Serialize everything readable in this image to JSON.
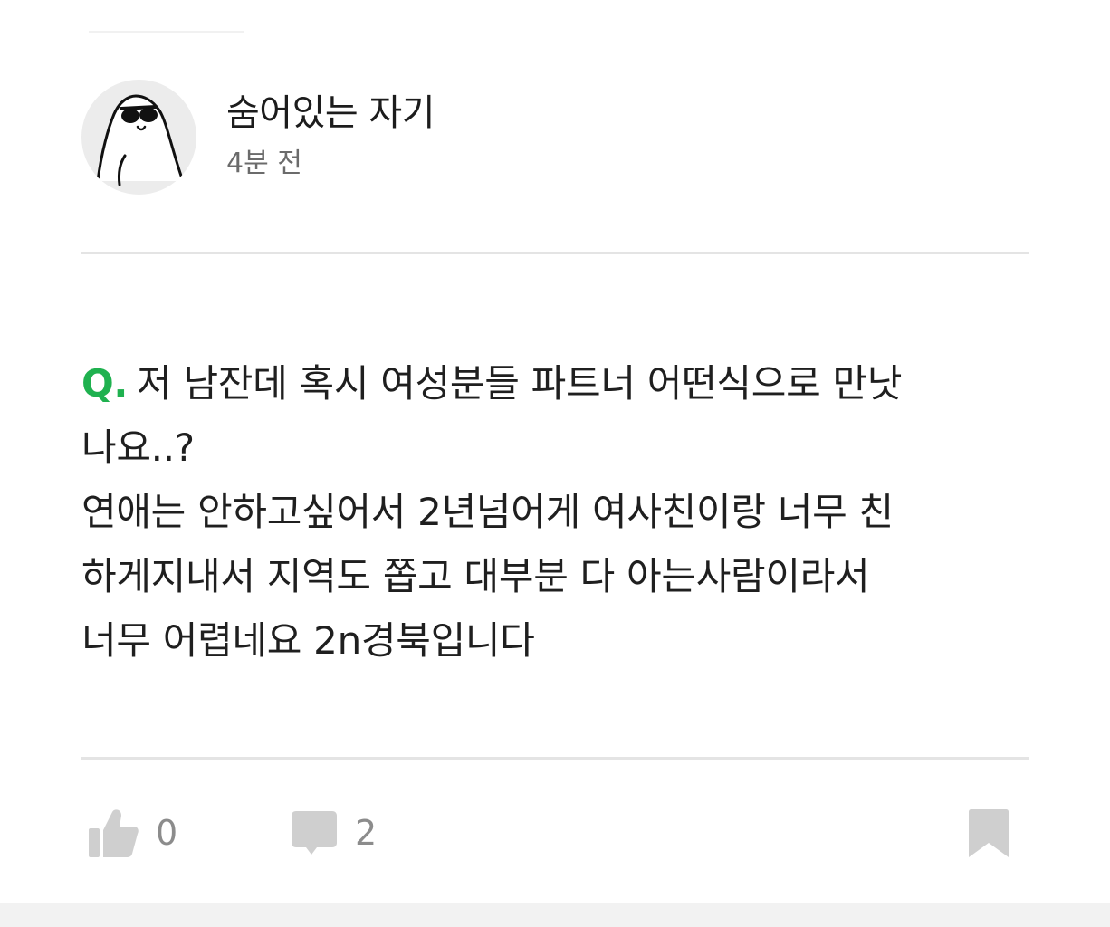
{
  "author": {
    "name": "숨어있는 자기",
    "time": "4분 전"
  },
  "question": {
    "marker": "Q.",
    "lines": [
      "저 남잔데 혹시 여성분들 파트너 어떤식으로 만낫",
      "나요..?",
      "연애는 안하고싶어서 2년넘어게 여사친이랑 너무 친",
      "하게지내서 지역도 쫍고 대부분 다 아는사람이라서",
      "너무 어렵네요 2n경북입니다"
    ]
  },
  "actions": {
    "like_count": "0",
    "comment_count": "2"
  },
  "colors": {
    "accent": "#1fb14f",
    "icon_gray": "#cfcfcf",
    "divider": "#e4e4e4"
  },
  "icons": {
    "like": "thumbs-up-icon",
    "comment": "comment-icon",
    "bookmark": "bookmark-icon",
    "avatar": "ghost-sunglasses-avatar"
  }
}
